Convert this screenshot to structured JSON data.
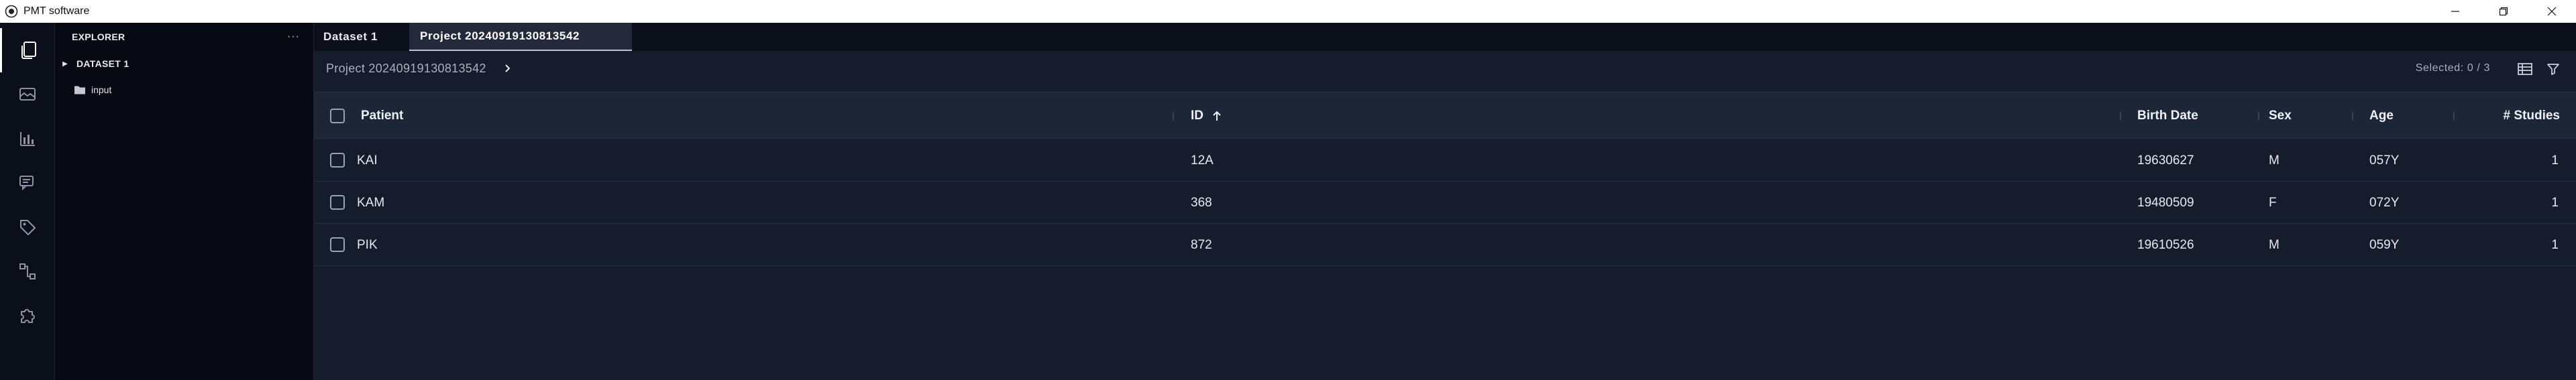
{
  "window": {
    "title": "PMT software",
    "buttons": {
      "minimize": "minimize",
      "restore": "restore",
      "close": "close"
    }
  },
  "activity_bar": {
    "items": [
      {
        "name": "files-icon",
        "active": true
      },
      {
        "name": "viewer-icon",
        "active": false
      },
      {
        "name": "chart-icon",
        "active": false
      },
      {
        "name": "comments-icon",
        "active": false
      },
      {
        "name": "tag-icon",
        "active": false
      },
      {
        "name": "pipeline-icon",
        "active": false
      },
      {
        "name": "plugin-icon",
        "active": false
      }
    ]
  },
  "explorer": {
    "title": "EXPLORER",
    "more": "···",
    "dataset": "DATASET 1",
    "folder": "input"
  },
  "tabs": [
    {
      "label": "Dataset 1",
      "active": false
    },
    {
      "label": "Project 20240919130813542",
      "active": true
    }
  ],
  "toolbar": {
    "breadcrumb": "Project 20240919130813542",
    "selected": "Selected: 0 / 3"
  },
  "table": {
    "columns": [
      "Patient",
      "ID",
      "Birth Date",
      "Sex",
      "Age",
      "# Studies"
    ],
    "sorted_column": "ID",
    "sort_direction": "ascending",
    "rows": [
      {
        "patient": "KAI",
        "id": "12A",
        "birth_date": "19630627",
        "sex": "M",
        "age": "057Y",
        "studies": "1"
      },
      {
        "patient": "KAM",
        "id": "368",
        "birth_date": "19480509",
        "sex": "F",
        "age": "072Y",
        "studies": "1"
      },
      {
        "patient": "PIK",
        "id": "872",
        "birth_date": "19610526",
        "sex": "M",
        "age": "059Y",
        "studies": "1"
      }
    ]
  },
  "colors": {
    "background": "#151c2c",
    "sidebar": "#060912",
    "activity_bar": "#0b0f1a",
    "header": "#1d2637",
    "text": "#e6e9ef",
    "muted": "#a9b1c0"
  }
}
